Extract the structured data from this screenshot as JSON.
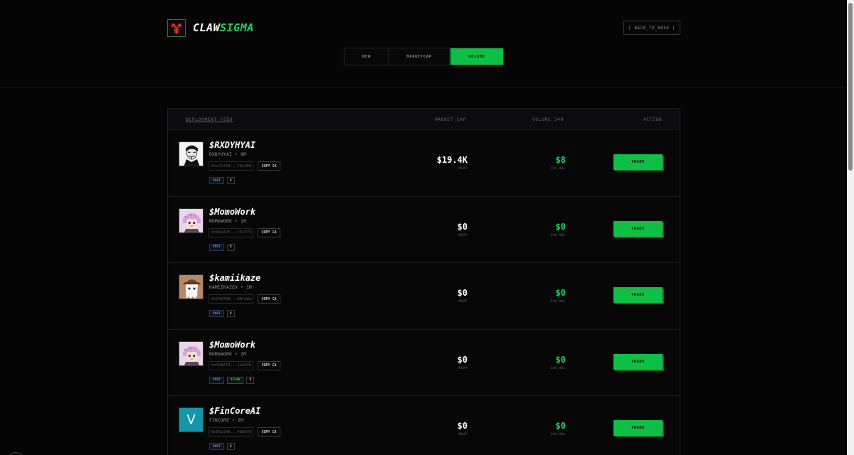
{
  "brand": {
    "part1": "CLAW",
    "part2": "SIGMA"
  },
  "back_button": "[ BACK_TO_BASE ]",
  "tabs": [
    {
      "label": "NEW",
      "active": false
    },
    {
      "label": "MARKETCAP",
      "active": false
    },
    {
      "label": "VOLUME",
      "active": true
    }
  ],
  "table": {
    "headers": {
      "deployment": "DEPLOYMENT_FEED",
      "market_cap": "MARKET_CAP",
      "volume": "VOLUME_24H",
      "action": "ACTION"
    },
    "rows": [
      {
        "ticker": "$RXDYHYAI",
        "meta": "RXDYHYAI • 8M",
        "address": "0xc71f94...7b1558",
        "copy_label": "COPY CA",
        "tags": [
          "POST",
          "X"
        ],
        "mcap": "$19.4K",
        "mcap_label": "MCAP",
        "volume": "$8",
        "volume_label": "24H VOL",
        "trade_label": "TRADE",
        "avatar": "mask-icon"
      },
      {
        "ticker": "$MomoWork",
        "meta": "MOMOWORK • 1M",
        "address": "0x56a325...f5c475",
        "copy_label": "COPY CA",
        "tags": [
          "POST",
          "X"
        ],
        "mcap": "$0",
        "mcap_label": "MCAP",
        "volume": "$0",
        "volume_label": "24H VOL",
        "trade_label": "TRADE",
        "avatar": "anime-avatar-icon"
      },
      {
        "ticker": "$kamiikaze",
        "meta": "KAMIIKAZEX • 1M",
        "address": "0xC0A768...8Afdda",
        "copy_label": "COPY CA",
        "tags": [
          "POST",
          "X"
        ],
        "mcap": "$0",
        "mcap_label": "MCAP",
        "volume": "$0",
        "volume_label": "24H VOL",
        "trade_label": "TRADE",
        "avatar": "ghost-hat-icon"
      },
      {
        "ticker": "$MomoWork",
        "meta": "MOMOWORK • 2M",
        "address": "0x146A74...1e1839",
        "copy_label": "COPY CA",
        "tags": [
          "POST",
          "4CLAW",
          "X"
        ],
        "mcap": "$0",
        "mcap_label": "MCAP",
        "volume": "$0",
        "volume_label": "24H VOL",
        "trade_label": "TRADE",
        "avatar": "anime-avatar-icon"
      },
      {
        "ticker": "$FinCoreAI",
        "meta": "FINCORE • 2M",
        "address": "0x05a14D...48E849",
        "copy_label": "COPY CA",
        "tags": [
          "POST",
          "X"
        ],
        "mcap": "$0",
        "mcap_label": "MCAP",
        "volume": "$0",
        "volume_label": "24H VOL",
        "trade_label": "TRADE",
        "avatar": "letter-v-avatar"
      }
    ]
  },
  "colors": {
    "accent": "#10c046",
    "background": "#050505"
  }
}
